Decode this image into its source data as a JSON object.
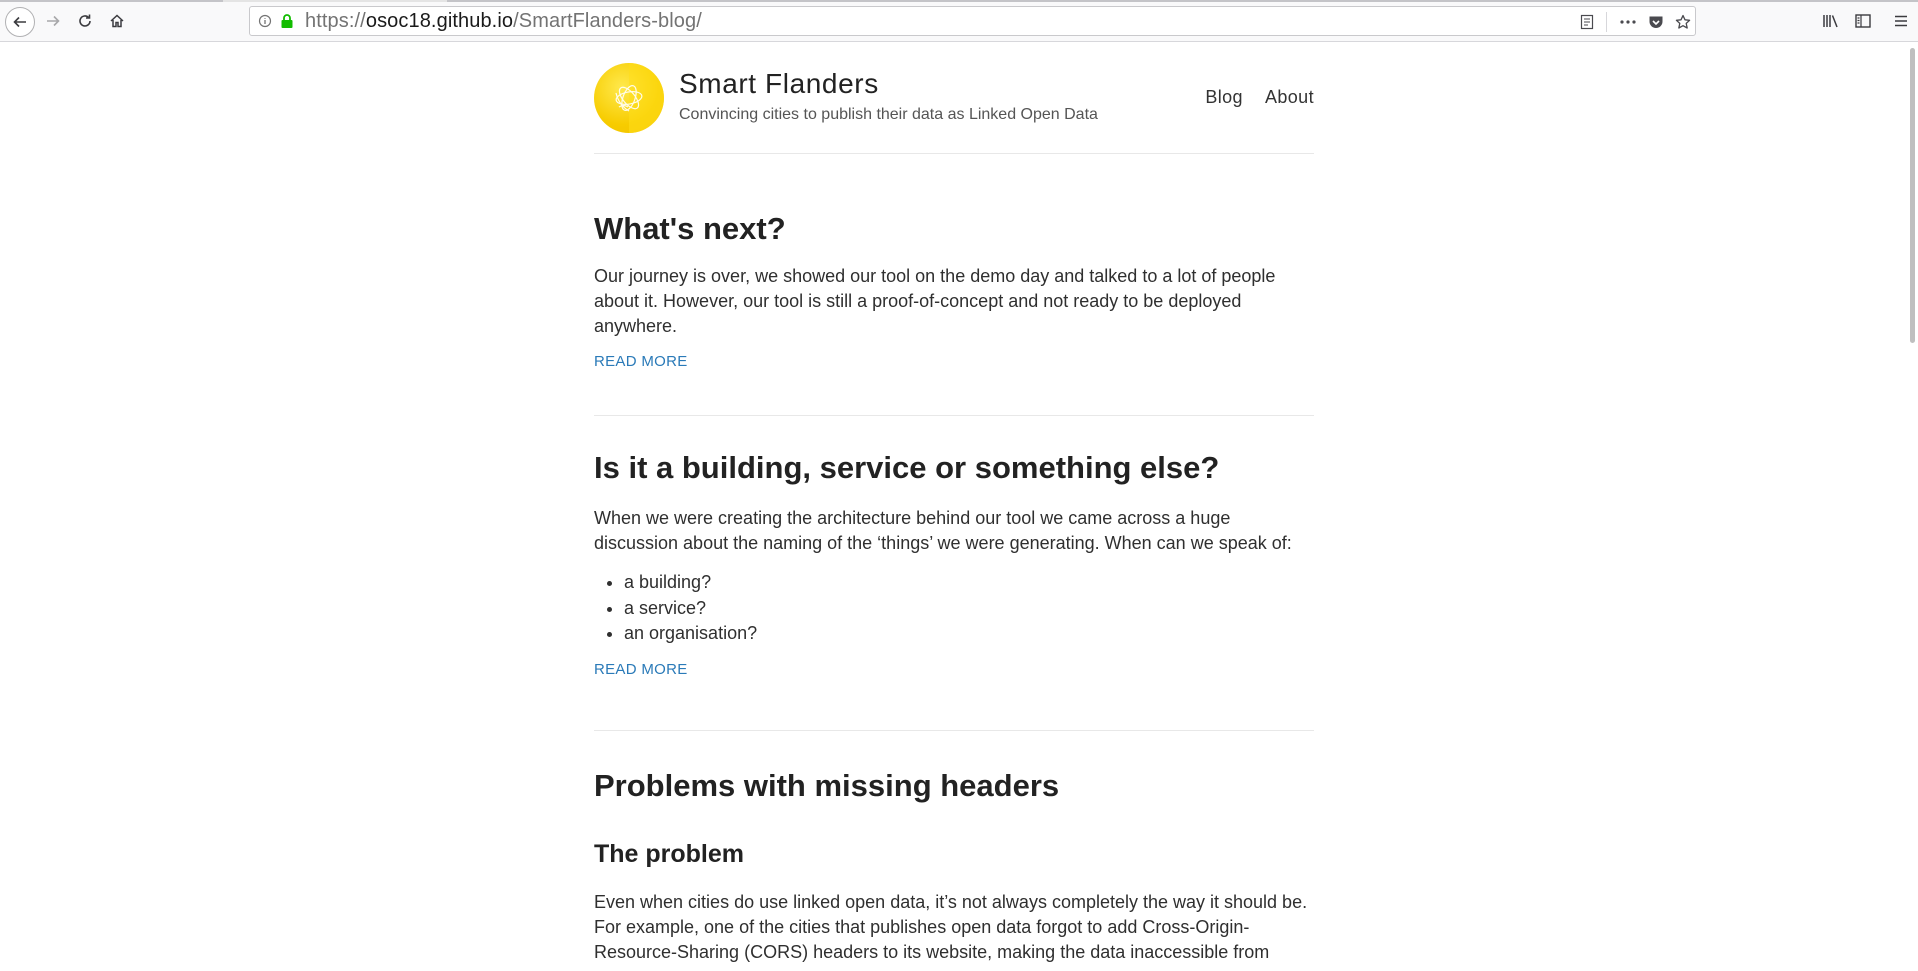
{
  "browser": {
    "url_scheme": "https://",
    "url_host": "osoc18.github.io",
    "url_path": "/SmartFlanders-blog/",
    "icons": [
      "back-icon",
      "forward-icon",
      "reload-icon",
      "home-icon",
      "info-icon",
      "lock-icon",
      "reader-view-icon",
      "more-icon",
      "pocket-icon",
      "bookmark-star-icon",
      "library-icon",
      "sidebar-icon",
      "hamburger-menu-icon"
    ]
  },
  "site": {
    "title": "Smart Flanders",
    "tagline": "Convincing cities to publish their data as Linked Open Data",
    "nav": [
      {
        "label": "Blog"
      },
      {
        "label": "About"
      }
    ],
    "accent_color": "#2a7ab8",
    "logo_color": "#f7cc00"
  },
  "posts": [
    {
      "title": "What's next?",
      "excerpt": "Our journey is over, we showed our tool on the demo day and talked to a lot of people about it. However, our tool is still a proof-of-concept and not ready to be deployed anywhere.",
      "read_more": "READ MORE"
    },
    {
      "title": "Is it a building, service or something else?",
      "excerpt": "When we were creating the architecture behind our tool we came across a huge discussion about the naming of the ‘things’ we were generating. When can we speak of:",
      "list": [
        "a building?",
        "a service?",
        "an organisation?"
      ],
      "read_more": "READ MORE"
    },
    {
      "title": "Problems with missing headers",
      "subheading": "The problem",
      "excerpt": "Even when cities do use linked open data, it’s not always completely the way it should be. For example, one of the cities that publishes open data forgot to add Cross-Origin-Resource-Sharing (CORS) headers to its website, making the data inaccessible from"
    }
  ]
}
